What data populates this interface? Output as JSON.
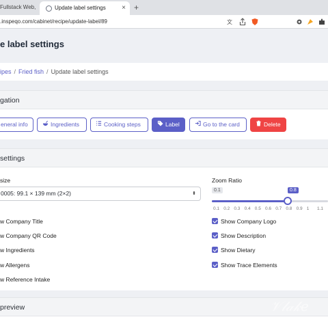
{
  "browser": {
    "inactive_tab_title": "Fullstack Web, Mo",
    "active_tab_title": "Update label settings",
    "tab_close": "×",
    "new_tab": "+",
    "url": ".inspeqo.com/cabinet/recipe/update-label/89"
  },
  "page": {
    "title": "e label settings"
  },
  "breadcrumb": {
    "link1": "ipes",
    "link2": "Fried fish",
    "current": "Update label settings",
    "sep": "/"
  },
  "navigation": {
    "header": "gation",
    "buttons": [
      {
        "label": "eneral info",
        "icon": "info-icon"
      },
      {
        "label": "Ingredients",
        "icon": "bowl-icon"
      },
      {
        "label": "Cooking steps",
        "icon": "list-icon"
      },
      {
        "label": "Label",
        "icon": "tag-icon"
      },
      {
        "label": "Go to the card",
        "icon": "enter-icon"
      },
      {
        "label": "Delete",
        "icon": "trash-icon"
      }
    ]
  },
  "settings": {
    "header": " settings",
    "size_label": "size",
    "size_value": "0005: 99.1 × 139 mm (2×2)",
    "zoom_label": "Zoom Ratio",
    "zoom_min": "0.1",
    "zoom_value": 0.8,
    "zoom_value_label": "0.8",
    "zoom_ticks": [
      "0.1",
      "0.2",
      "0.3",
      "0.4",
      "0.5",
      "0.6",
      "0.7",
      "0.8",
      "0.9",
      "1",
      "1.1"
    ],
    "left_options": [
      "w Company Title",
      "w Company QR Code",
      "w Ingredients",
      "w Allergens",
      "w Reference Intake"
    ],
    "right_options": [
      "Show Company Logo",
      "Show Description",
      "Show Dietary",
      "Show Trace Elements"
    ]
  },
  "preview": {
    "header": " preview"
  },
  "colors": {
    "accent": "#5b5fc7",
    "danger": "#ef4444"
  }
}
